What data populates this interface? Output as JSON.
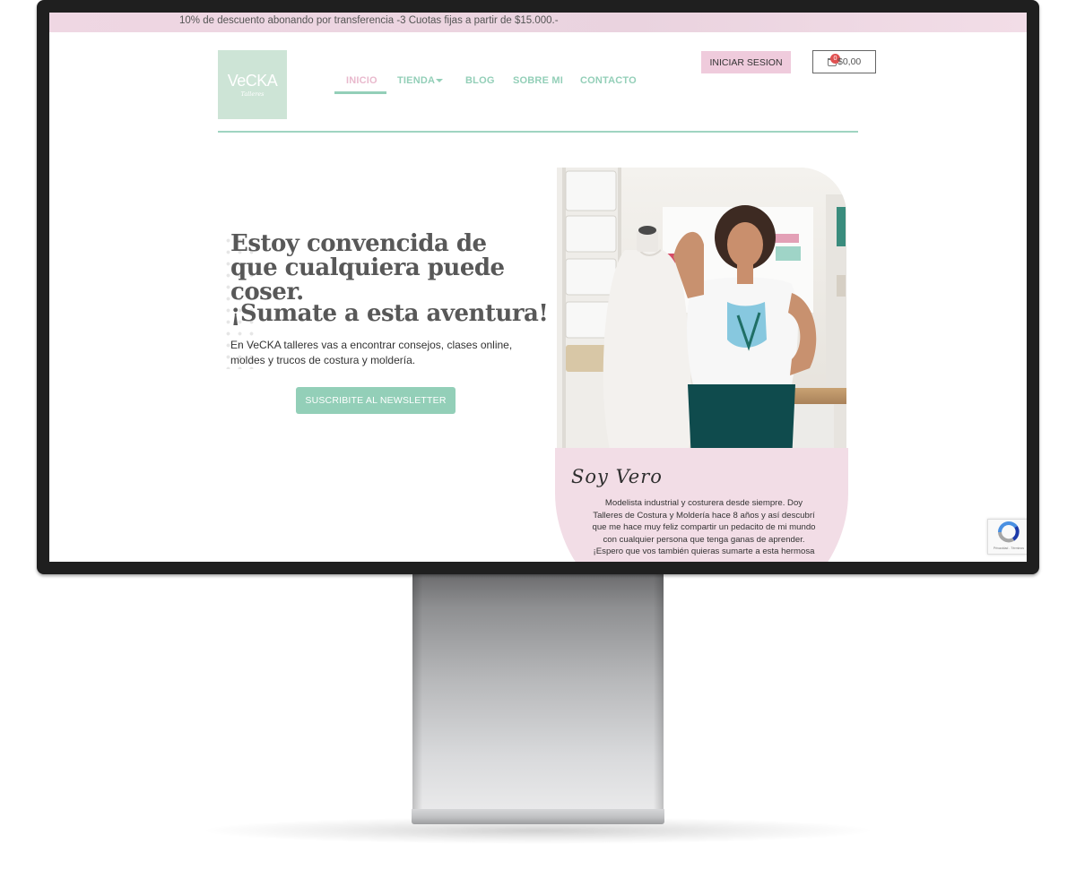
{
  "promo": {
    "text": "10% de descuento abonando por transferencia -3 Cuotas fijas a partir de $15.000.-"
  },
  "logo": {
    "name": "VeCKA",
    "sub": "Talleres"
  },
  "nav": {
    "items": [
      {
        "label": "INICIO",
        "active": true
      },
      {
        "label": "TIENDA",
        "has_dropdown": true
      },
      {
        "label": "BLOG"
      },
      {
        "label": "SOBRE MI"
      },
      {
        "label": "CONTACTO"
      }
    ]
  },
  "header": {
    "login_label": "INICIAR SESION",
    "cart_count": "0",
    "cart_amount": "$0,00"
  },
  "hero": {
    "title": "Estoy convencida de que cualquiera puede coser.",
    "subtitle": "¡Sumate a esta aventura!",
    "description": "En VeCKA talleres vas a encontrar consejos, clases online, moldes y trucos de costura y moldería.",
    "button_label": "SUSCRIBITE AL NEWSLETTER"
  },
  "about": {
    "title": "Soy Vero",
    "text": "Modelista industrial y costurera desde siempre. Doy Talleres de Costura y Moldería hace 8 años y así descubrí que me hace muy feliz compartir un pedacito de mi mundo con cualquier persona que tenga ganas de aprender. ¡Espero que vos también quieras sumarte a esta hermosa"
  },
  "recaptcha": {
    "label": "Privacidad - Términos"
  },
  "colors": {
    "mint": "#93cfb8",
    "pink": "#efcbdc",
    "promo_bg": "#ead3df",
    "logo_bg": "#cde4d6",
    "about_bg": "#f2dde6"
  }
}
